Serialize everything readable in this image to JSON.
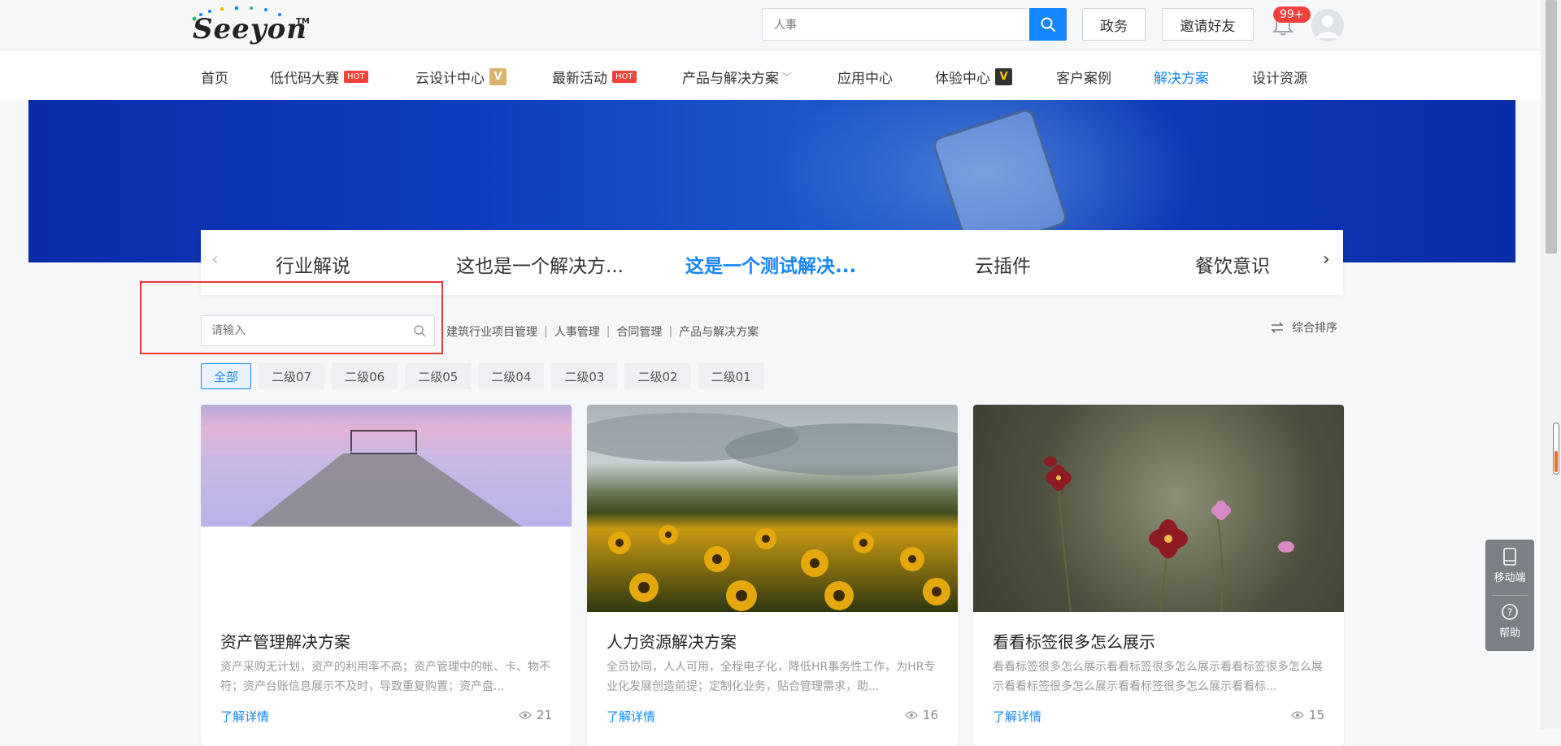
{
  "header": {
    "logo_text": "Seeyon",
    "logo_tm": "TM",
    "search": {
      "value": "人事",
      "button_icon": "search-icon"
    },
    "gov_button": "政务",
    "invite_button": "邀请好友",
    "notification_badge": "99+",
    "accent_color": "#1486ff"
  },
  "nav": {
    "items": [
      {
        "label": "首页"
      },
      {
        "label": "低代码大赛",
        "tag": "HOT"
      },
      {
        "label": "云设计中心",
        "tag": "V"
      },
      {
        "label": "最新活动",
        "tag": "HOT"
      },
      {
        "label": "产品与解决方案",
        "dropdown": true
      },
      {
        "label": "应用中心"
      },
      {
        "label": "体验中心",
        "tag": "V"
      },
      {
        "label": "客户案例"
      },
      {
        "label": "解决方案",
        "active": true
      },
      {
        "label": "设计资源"
      }
    ]
  },
  "categories": {
    "items": [
      {
        "label": "行业解说"
      },
      {
        "label": "这也是一个解决方..."
      },
      {
        "label": "这是一个测试解决...",
        "active": true
      },
      {
        "label": "云插件"
      },
      {
        "label": "餐饮意识"
      }
    ]
  },
  "filters": {
    "search_placeholder": "请输入",
    "quick_tags": [
      "建筑行业项目管理",
      "人事管理",
      "合同管理",
      "产品与解决方案"
    ],
    "sort_label": "综合排序",
    "chips": [
      {
        "label": "全部",
        "active": true
      },
      {
        "label": "二级07"
      },
      {
        "label": "二级06"
      },
      {
        "label": "二级05"
      },
      {
        "label": "二级04"
      },
      {
        "label": "二级03"
      },
      {
        "label": "二级02"
      },
      {
        "label": "二级01"
      }
    ]
  },
  "cards": [
    {
      "title": "资产管理解决方案",
      "desc": "资产采购无计划，资产的利用率不高；资产管理中的帐、卡、物不符；资产台账信息展示不及时，导致重复购置；资产盘...",
      "more": "了解详情",
      "views": "21"
    },
    {
      "title": "人力资源解决方案",
      "desc": "全员协同，人人可用，全程电子化，降低HR事务性工作，为HR专业化发展创造前提；定制化业务，贴合管理需求，助...",
      "more": "了解详情",
      "views": "16"
    },
    {
      "title": "看看标签很多怎么展示",
      "desc": "看看标签很多怎么展示看看标签很多怎么展示看看标签很多怎么展示看看标签很多怎么展示看看标签很多怎么展示看看标...",
      "more": "了解详情",
      "views": "15"
    }
  ],
  "float_panel": {
    "mobile_label": "移动端",
    "help_label": "帮助"
  }
}
